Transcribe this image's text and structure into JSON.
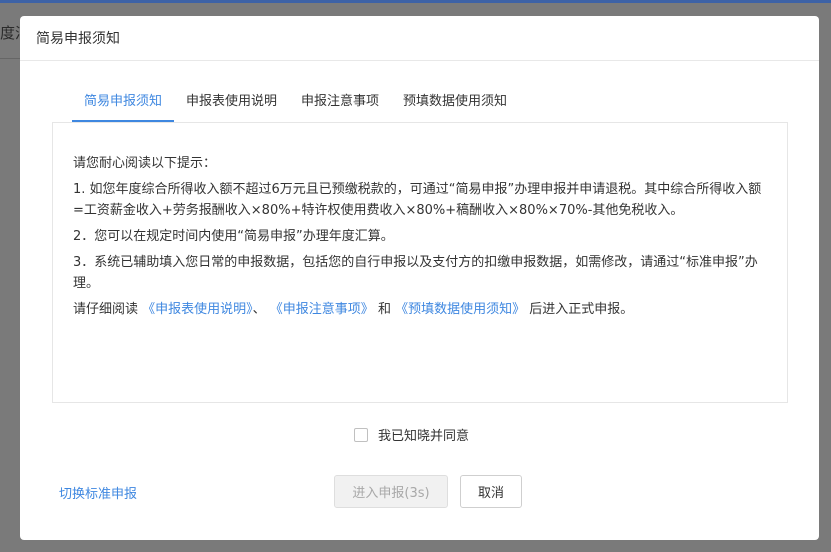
{
  "backdrop": {
    "partial_text": "度汇"
  },
  "dialog": {
    "title": "简易申报须知",
    "tabs": [
      {
        "label": "简易申报须知",
        "active": true
      },
      {
        "label": "申报表使用说明",
        "active": false
      },
      {
        "label": "申报注意事项",
        "active": false
      },
      {
        "label": "预填数据使用须知",
        "active": false
      }
    ],
    "content": {
      "heading": "请您耐心阅读以下提示：",
      "item1": "1. 如您年度综合所得收入额不超过6万元且已预缴税款的，可通过“简易申报”办理申报并申请退税。其中综合所得收入额=工资薪金收入+劳务报酬收入×80%+特许权使用费收入×80%+稿酬收入×80%×70%-其他免税收入。",
      "item2": "2．您可以在规定时间内使用“简易申报”办理年度汇算。",
      "item3": "3．系统已辅助填入您日常的申报数据，包括您的自行申报以及支付方的扣缴申报数据，如需修改，请通过“标准申报”办理。",
      "read_prefix": "请仔细阅读 ",
      "link1": "《申报表使用说明》",
      "sep1": "、 ",
      "link2": "《申报注意事项》",
      "sep2": " 和 ",
      "link3": "《预填数据使用须知》",
      "read_suffix": " 后进入正式申报。"
    },
    "agree_label": "我已知晓并同意",
    "agree_checked": false,
    "switch_link": "切换标准申报",
    "enter_button": "进入申报(3s)",
    "cancel_button": "取消"
  },
  "colors": {
    "accent": "#3e87e0",
    "overlay": "#7a7a7a",
    "disabled_text": "#a8a8a8"
  }
}
